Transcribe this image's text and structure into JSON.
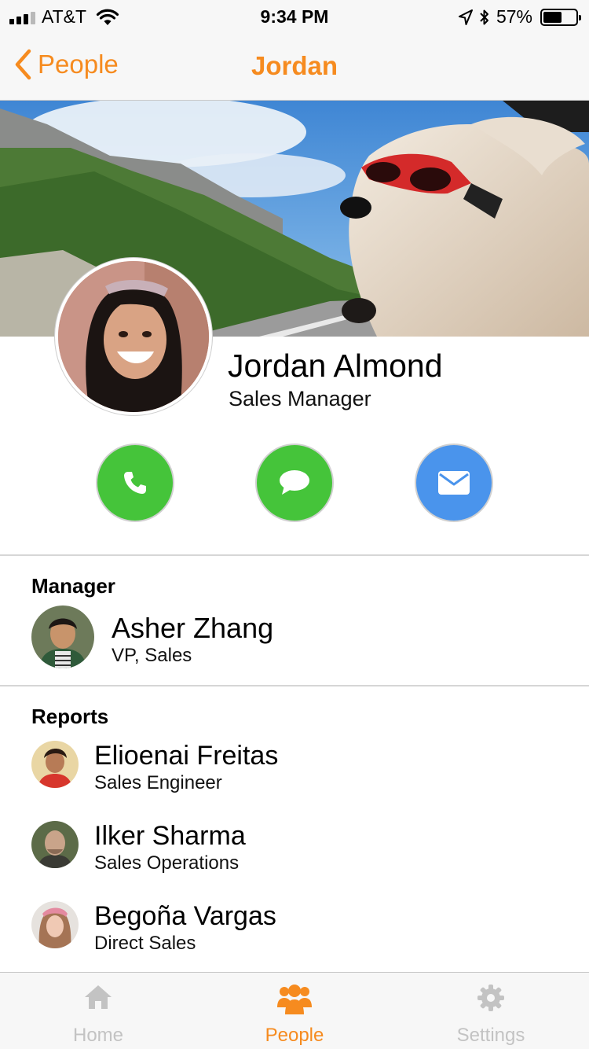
{
  "status_bar": {
    "carrier": "AT&T",
    "time": "9:34 PM",
    "battery_text": "57%",
    "battery_level": 0.57
  },
  "nav": {
    "back_label": "People",
    "title": "Jordan"
  },
  "profile": {
    "name": "Jordan Almond",
    "title": "Sales Manager"
  },
  "actions": [
    {
      "icon": "phone-icon",
      "color": "#45c43a"
    },
    {
      "icon": "message-bubble-icon",
      "color": "#45c43a"
    },
    {
      "icon": "envelope-icon",
      "color": "#4a94ec"
    }
  ],
  "manager": {
    "heading": "Manager",
    "name": "Asher Zhang",
    "title": "VP, Sales"
  },
  "reports": {
    "heading": "Reports",
    "items": [
      {
        "name": "Elioenai Freitas",
        "title": "Sales Engineer"
      },
      {
        "name": "Ilker Sharma",
        "title": "Sales Operations"
      },
      {
        "name": "Begoña Vargas",
        "title": "Direct Sales"
      }
    ]
  },
  "tabs": [
    {
      "label": "Home",
      "icon": "home-icon",
      "active": false
    },
    {
      "label": "People",
      "icon": "people-icon",
      "active": true
    },
    {
      "label": "Settings",
      "icon": "gear-icon",
      "active": false
    }
  ],
  "colors": {
    "accent": "#f68b1f",
    "inactive_tab": "#c3c3c3",
    "call_green": "#45c43a",
    "email_blue": "#4a94ec"
  }
}
